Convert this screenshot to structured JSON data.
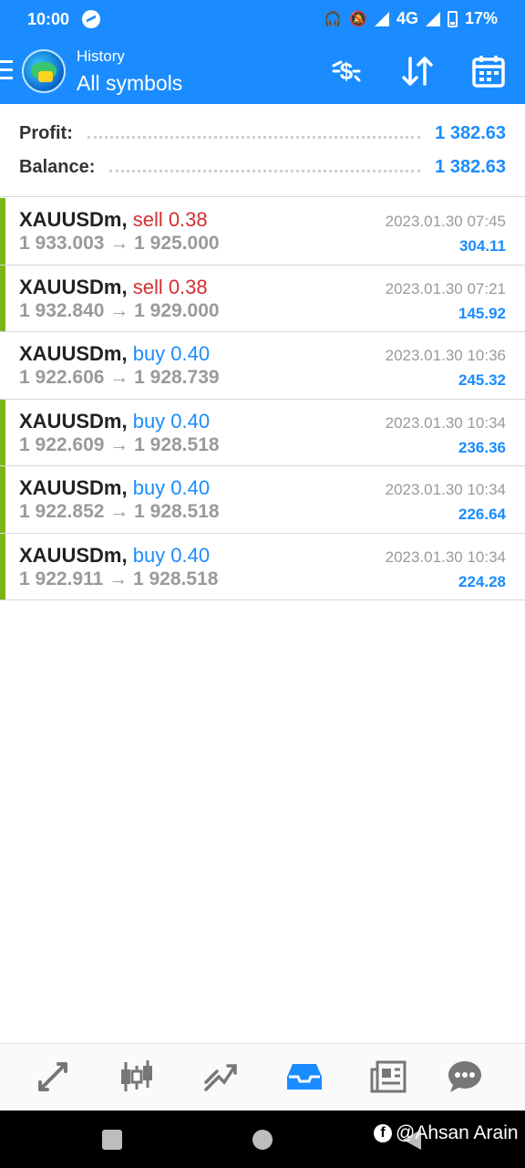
{
  "status": {
    "time": "10:00",
    "network": "4G",
    "battery": "17%"
  },
  "header": {
    "subtitle": "History",
    "title": "All symbols"
  },
  "summary": [
    {
      "label": "Profit:",
      "value": "1 382.63"
    },
    {
      "label": "Balance:",
      "value": "1 382.63"
    }
  ],
  "trades": [
    {
      "symbol": "XAUUSDm,",
      "direction": "sell 0.38",
      "side": "sell",
      "open": "1 933.003",
      "close": "1 925.000",
      "time": "2023.01.30 07:45",
      "profit": "304.11",
      "highlight": true
    },
    {
      "symbol": "XAUUSDm,",
      "direction": "sell 0.38",
      "side": "sell",
      "open": "1 932.840",
      "close": "1 929.000",
      "time": "2023.01.30 07:21",
      "profit": "145.92",
      "highlight": true
    },
    {
      "symbol": "XAUUSDm,",
      "direction": "buy 0.40",
      "side": "buy",
      "open": "1 922.606",
      "close": "1 928.739",
      "time": "2023.01.30 10:36",
      "profit": "245.32",
      "highlight": false
    },
    {
      "symbol": "XAUUSDm,",
      "direction": "buy 0.40",
      "side": "buy",
      "open": "1 922.609",
      "close": "1 928.518",
      "time": "2023.01.30 10:34",
      "profit": "236.36",
      "highlight": true
    },
    {
      "symbol": "XAUUSDm,",
      "direction": "buy 0.40",
      "side": "buy",
      "open": "1 922.852",
      "close": "1 928.518",
      "time": "2023.01.30 10:34",
      "profit": "226.64",
      "highlight": true
    },
    {
      "symbol": "XAUUSDm,",
      "direction": "buy 0.40",
      "side": "buy",
      "open": "1 922.911",
      "close": "1 928.518",
      "time": "2023.01.30 10:34",
      "profit": "224.28",
      "highlight": true
    }
  ],
  "colors": {
    "accent": "#1a8cff",
    "sell": "#d32f2f",
    "buy": "#1a8cff",
    "highlight": "#7cb518"
  },
  "bottom_nav": [
    "quotes-icon",
    "chart-icon",
    "trade-icon",
    "history-icon",
    "news-icon",
    "chat-icon"
  ],
  "watermark": "@Ahsan Arain"
}
